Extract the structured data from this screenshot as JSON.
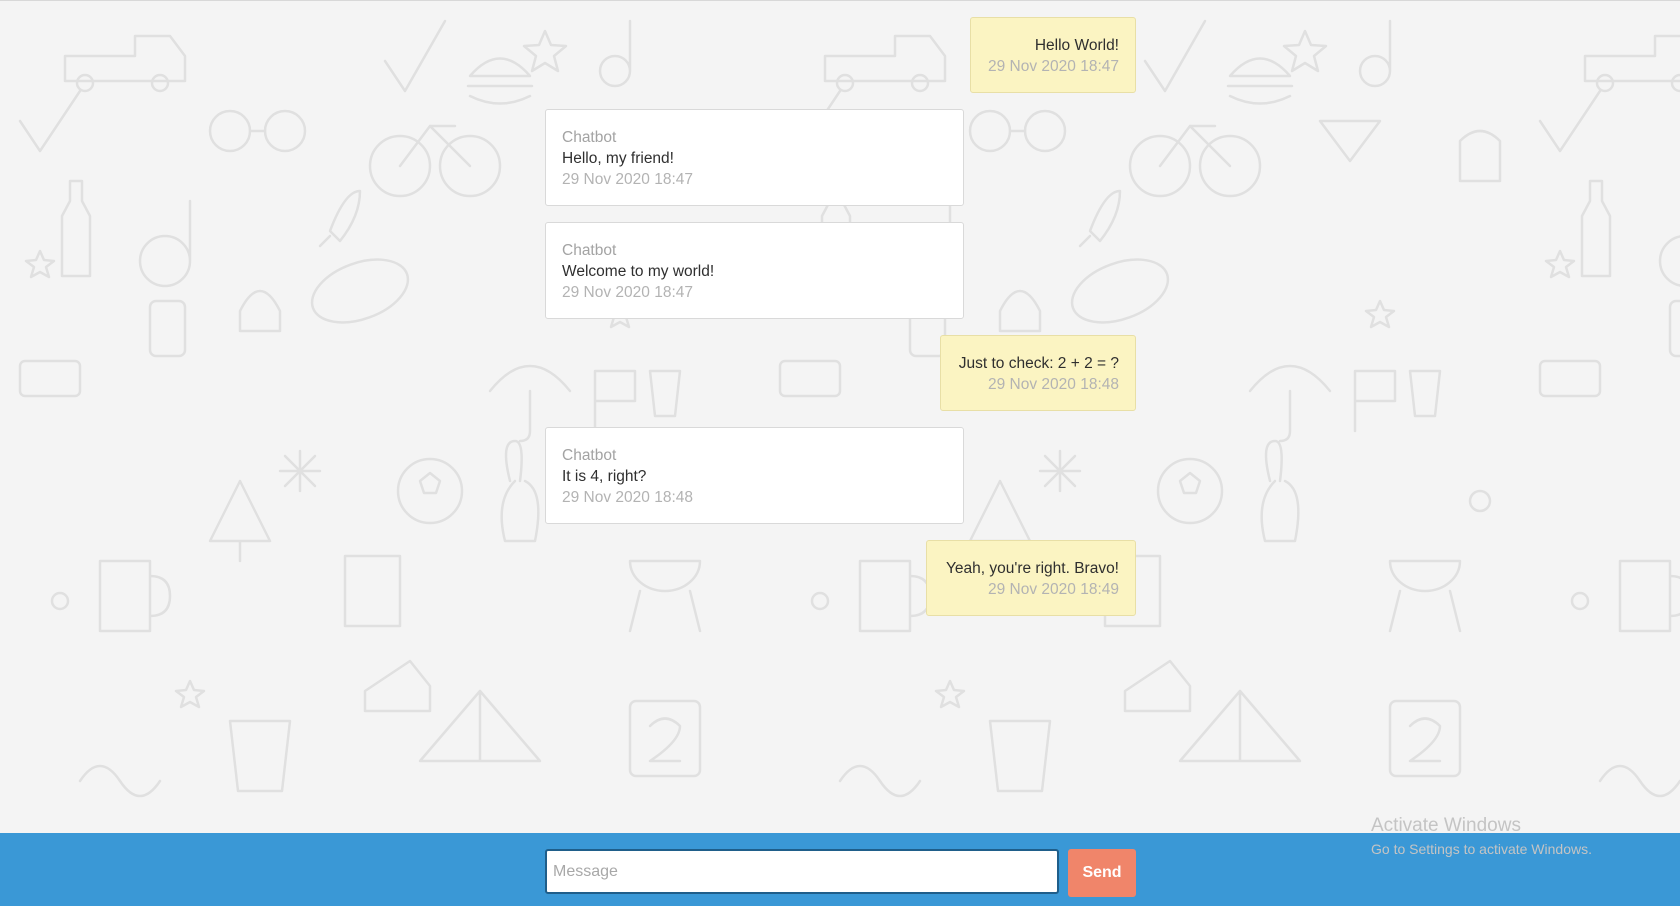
{
  "messages": [
    {
      "from": "user",
      "text": "Hello World!",
      "time": "29 Nov 2020 18:47"
    },
    {
      "from": "bot",
      "sender": "Chatbot",
      "text": "Hello, my friend!",
      "time": "29 Nov 2020 18:47"
    },
    {
      "from": "bot",
      "sender": "Chatbot",
      "text": "Welcome to my world!",
      "time": "29 Nov 2020 18:47"
    },
    {
      "from": "user",
      "text": "Just to check: 2 + 2 = ?",
      "time": "29 Nov 2020 18:48"
    },
    {
      "from": "bot",
      "sender": "Chatbot",
      "text": "It is 4, right?",
      "time": "29 Nov 2020 18:48"
    },
    {
      "from": "user",
      "text": "Yeah, you're right. Bravo!",
      "time": "29 Nov 2020 18:49"
    }
  ],
  "composer": {
    "placeholder": "Message",
    "value": "",
    "send_label": "Send"
  },
  "watermark": {
    "title": "Activate Windows",
    "subtitle": "Go to Settings to activate Windows."
  },
  "colors": {
    "footer": "#3a98d6",
    "send_button": "#f0856a",
    "user_bubble": "#fbf4c2",
    "bot_bubble": "#ffffff",
    "background": "#f4f4f4"
  }
}
